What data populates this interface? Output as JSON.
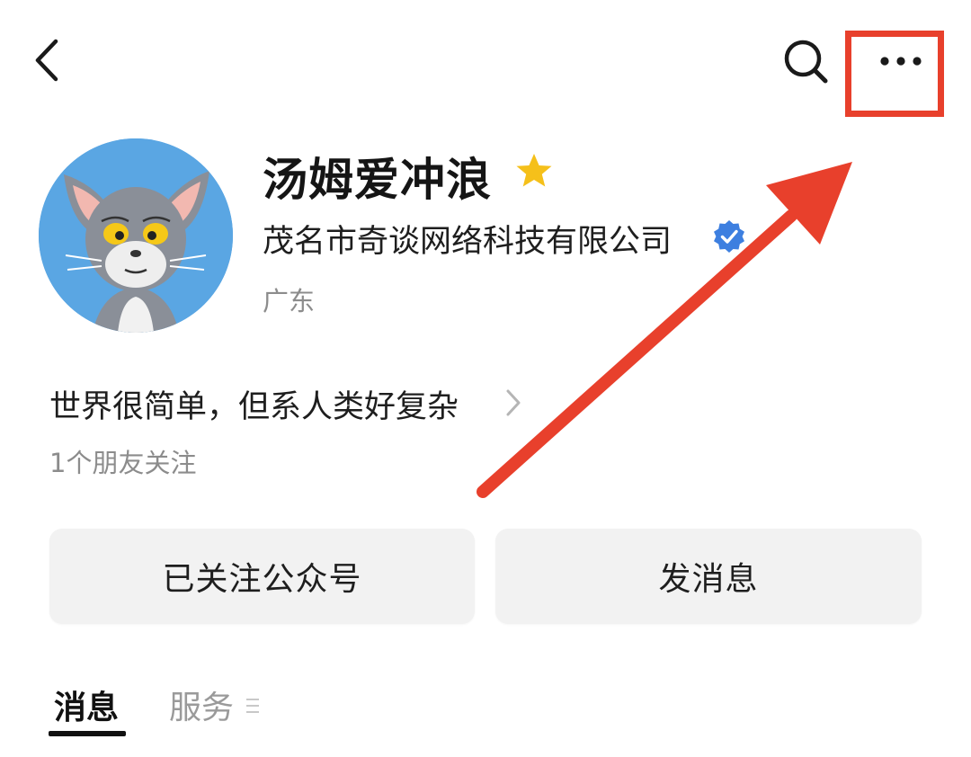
{
  "colors": {
    "accent_red": "#e8402c",
    "star_gold": "#f5c01a",
    "verified_blue": "#3d7fe0",
    "button_bg": "#f2f2f2",
    "muted_text": "#8c8c8c"
  },
  "icons": {
    "back": "chevron-left-icon",
    "search": "search-icon",
    "more": "more-horizontal-icon",
    "star": "star-icon",
    "verified": "verified-badge-icon",
    "bio_arrow": "chevron-right-icon",
    "services_menu": "menu-lines-icon"
  },
  "profile": {
    "name": "汤姆爱冲浪",
    "company": "茂名市奇谈网络科技有限公司",
    "region": "广东",
    "bio": "世界很简单，但系人类好复杂",
    "followers_text": "1个朋友关注"
  },
  "actions": {
    "follow_label": "已关注公众号",
    "message_label": "发消息"
  },
  "tabs": [
    {
      "label": "消息",
      "active": true
    },
    {
      "label": "服务",
      "active": false
    }
  ]
}
